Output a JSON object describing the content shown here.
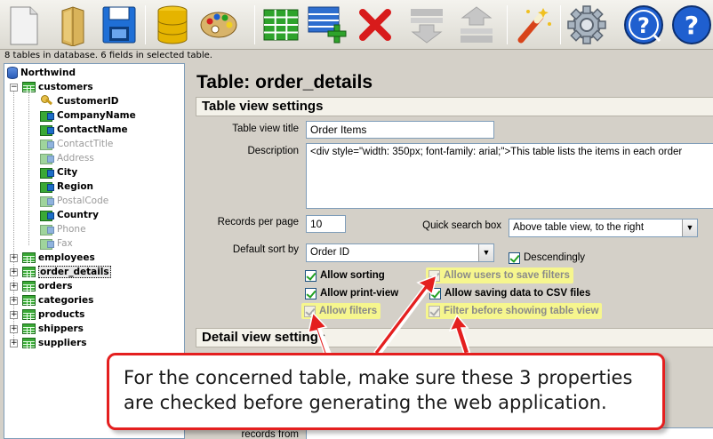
{
  "toolbar": {
    "buttons": [
      {
        "name": "new-file-icon"
      },
      {
        "name": "open-folder-icon"
      },
      {
        "name": "save-icon"
      },
      {
        "name": "database-icon"
      },
      {
        "name": "palette-icon"
      },
      {
        "name": "table-grid-icon"
      },
      {
        "name": "add-table-icon"
      },
      {
        "name": "delete-icon"
      },
      {
        "name": "move-down-icon"
      },
      {
        "name": "move-up-icon"
      },
      {
        "name": "magic-wand-icon"
      },
      {
        "name": "gear-icon"
      },
      {
        "name": "help-icon"
      },
      {
        "name": "about-icon"
      }
    ]
  },
  "status_text": "8 tables in database. 6 fields in selected table.",
  "tree": {
    "root": "Northwind",
    "tables": [
      {
        "label": "customers",
        "expanded": true,
        "fields": [
          {
            "label": "CustomerID",
            "key": true,
            "muted": false
          },
          {
            "label": "CompanyName",
            "muted": false
          },
          {
            "label": "ContactName",
            "muted": false
          },
          {
            "label": "ContactTitle",
            "muted": true
          },
          {
            "label": "Address",
            "muted": true
          },
          {
            "label": "City",
            "muted": false
          },
          {
            "label": "Region",
            "muted": false
          },
          {
            "label": "PostalCode",
            "muted": true
          },
          {
            "label": "Country",
            "muted": false
          },
          {
            "label": "Phone",
            "muted": true
          },
          {
            "label": "Fax",
            "muted": true
          }
        ]
      },
      {
        "label": "employees"
      },
      {
        "label": "order_details",
        "selected": true
      },
      {
        "label": "orders"
      },
      {
        "label": "categories"
      },
      {
        "label": "products"
      },
      {
        "label": "shippers"
      },
      {
        "label": "suppliers"
      }
    ]
  },
  "main": {
    "title": "Table: order_details",
    "table_view_header": "Table view settings",
    "table_view_title_label": "Table view title",
    "table_view_title_value": "Order Items",
    "description_label": "Description",
    "description_value": "<div style=\"width: 350px; font-family: arial;\">This table lists the items in each order",
    "records_per_page_label": "Records per page",
    "records_per_page_value": "10",
    "quick_search_label": "Quick search box",
    "quick_search_value": "Above table view, to the right",
    "default_sort_label": "Default sort by",
    "default_sort_value": "Order ID",
    "descendingly_label": "Descendingly",
    "checkboxes": {
      "allow_sorting": "Allow sorting",
      "allow_print_view": "Allow print-view",
      "allow_filters": "Allow filters",
      "allow_save_filters": "Allow users to save filters",
      "allow_csv": "Allow saving data to CSV files",
      "filter_before": "Filter before showing table view"
    },
    "detail_view_header": "Detail view settings",
    "records_from_label": "records from"
  },
  "callout": {
    "line1": "For the concerned table, make sure these 3 properties",
    "line2": "are checked before generating the web application."
  },
  "colors": {
    "highlight": "#f6f68e",
    "callout_border": "#e41f1f",
    "arrow": "#e41f1f"
  }
}
